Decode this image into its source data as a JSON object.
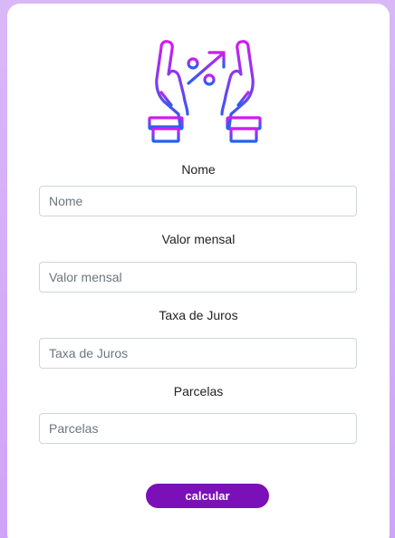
{
  "logo": {
    "icon": "hands-percent-growth-icon",
    "color_top": "#d21bf0",
    "color_bottom": "#1f63f0"
  },
  "form": {
    "fields": [
      {
        "label": "Nome",
        "placeholder": "Nome",
        "value": ""
      },
      {
        "label": "Valor mensal",
        "placeholder": "Valor mensal",
        "value": ""
      },
      {
        "label": "Taxa de Juros",
        "placeholder": "Taxa de Juros",
        "value": ""
      },
      {
        "label": "Parcelas",
        "placeholder": "Parcelas",
        "value": ""
      }
    ],
    "submit_label": "calcular"
  },
  "colors": {
    "background": "#d4abf6",
    "card": "#ffffff",
    "button": "#7b0fb8"
  }
}
